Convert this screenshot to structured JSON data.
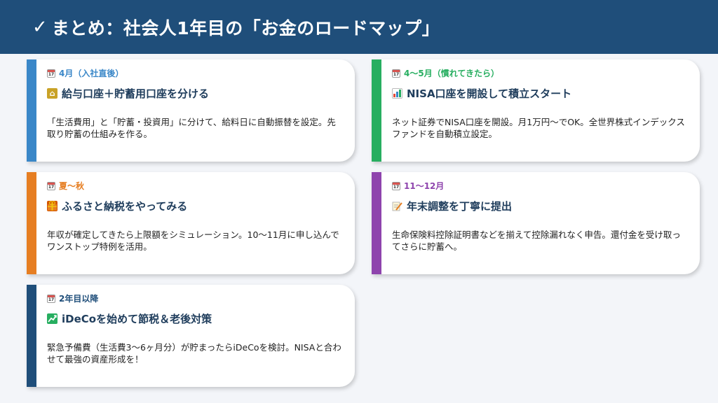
{
  "header": {
    "check": "✓",
    "title": "まとめ：社会人1年目の「お金のロードマップ」"
  },
  "cards": [
    {
      "period": "4月（入社直後）",
      "heading": "給与口座＋貯蓄用口座を分ける",
      "description": "「生活費用」と「貯蓄・投資用」に分けて、給料日に自動振替を設定。先取り貯蓄の仕組みを作る。",
      "accent": "#3a87c8",
      "icon": "bank-icon"
    },
    {
      "period": "4〜5月（慣れてきたら）",
      "heading": "NISA口座を開設して積立スタート",
      "description": "ネット証券でNISA口座を開設。月1万円〜でOK。全世界株式インデックスファンドを自動積立設定。",
      "accent": "#27ae60",
      "icon": "bar-chart-icon"
    },
    {
      "period": "夏〜秋",
      "heading": "ふるさと納税をやってみる",
      "description": "年収が確定してきたら上限額をシミュレーション。10〜11月に申し込んでワンストップ特例を活用。",
      "accent": "#e67e22",
      "icon": "gift-icon"
    },
    {
      "period": "11〜12月",
      "heading": "年末調整を丁寧に提出",
      "description": "生命保険料控除証明書などを揃えて控除漏れなく申告。還付金を受け取ってさらに貯蓄へ。",
      "accent": "#8e44ad",
      "icon": "memo-icon"
    },
    {
      "period": "2年目以降",
      "heading": "iDeCoを始めて節税＆老後対策",
      "description": "緊急予備費（生活費3〜6ヶ月分）が貯まったらiDeCoを検討。NISAと合わせて最強の資産形成を！",
      "accent": "#1f4e7a",
      "icon": "chart-increasing-icon"
    }
  ]
}
